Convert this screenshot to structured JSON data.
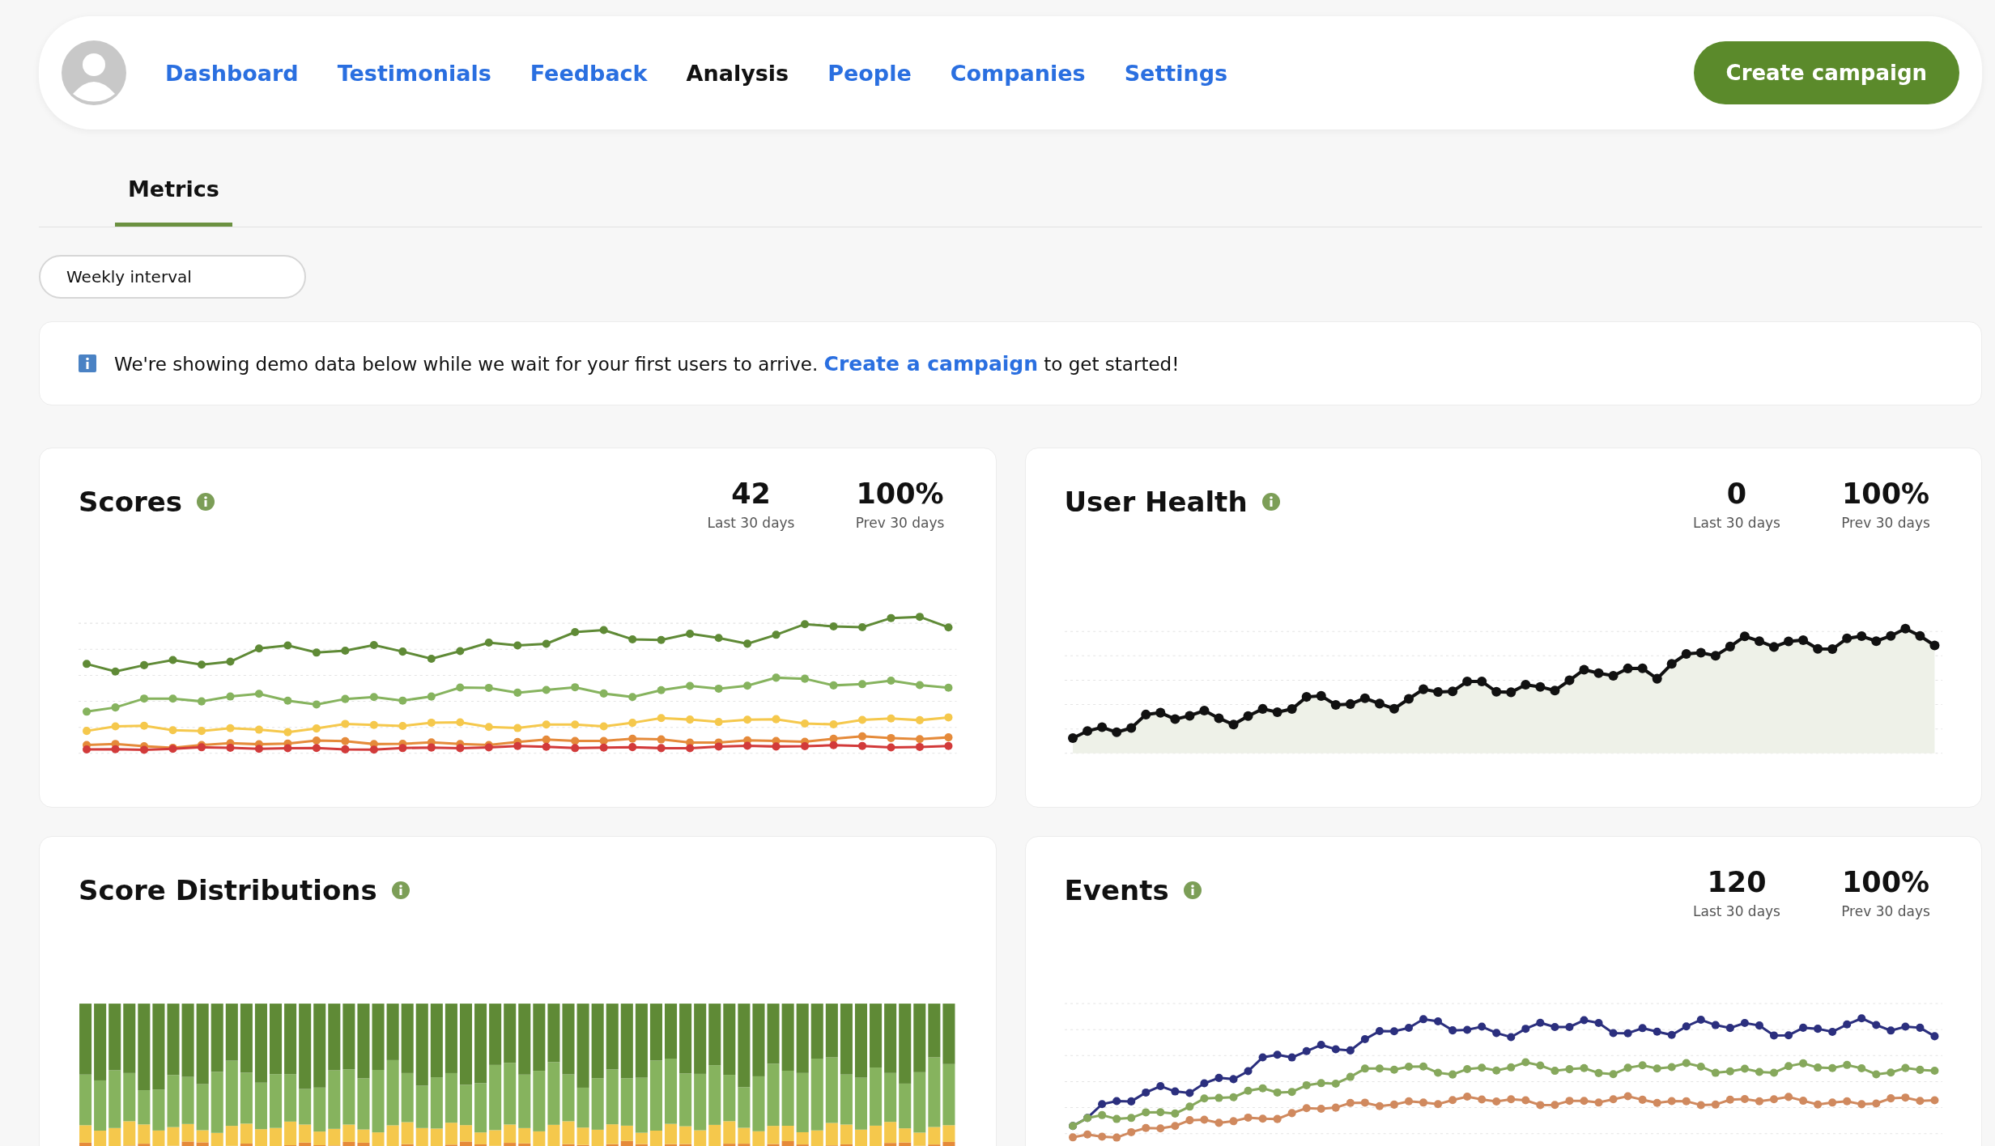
{
  "nav": {
    "items": [
      {
        "label": "Dashboard",
        "selected": false
      },
      {
        "label": "Testimonials",
        "selected": false
      },
      {
        "label": "Feedback",
        "selected": false
      },
      {
        "label": "Analysis",
        "selected": true
      },
      {
        "label": "People",
        "selected": false
      },
      {
        "label": "Companies",
        "selected": false
      },
      {
        "label": "Settings",
        "selected": false
      }
    ],
    "button": "Create campaign"
  },
  "tabs": [
    {
      "label": "Metrics",
      "selected": true
    }
  ],
  "interval_select": {
    "value": "Weekly interval"
  },
  "banner": {
    "before": "We're showing demo data below while we wait for your first users to arrive.",
    "link": "Create a campaign",
    "after": "to get started!"
  },
  "cards": [
    {
      "title": "Scores",
      "kind": "lines",
      "stats": [
        {
          "value": "42",
          "label": "Last 30 days"
        },
        {
          "value": "100%",
          "label": "Prev 30 days"
        }
      ]
    },
    {
      "title": "User Health",
      "kind": "area",
      "stats": [
        {
          "value": "0",
          "label": "Last 30 days"
        },
        {
          "value": "100%",
          "label": "Prev 30 days"
        }
      ]
    },
    {
      "title": "Score Distributions",
      "kind": "bars"
    },
    {
      "title": "Events",
      "kind": "events",
      "stats": [
        {
          "value": "120",
          "label": "Last 30 days"
        },
        {
          "value": "100%",
          "label": "Prev 30 days"
        }
      ]
    }
  ]
}
